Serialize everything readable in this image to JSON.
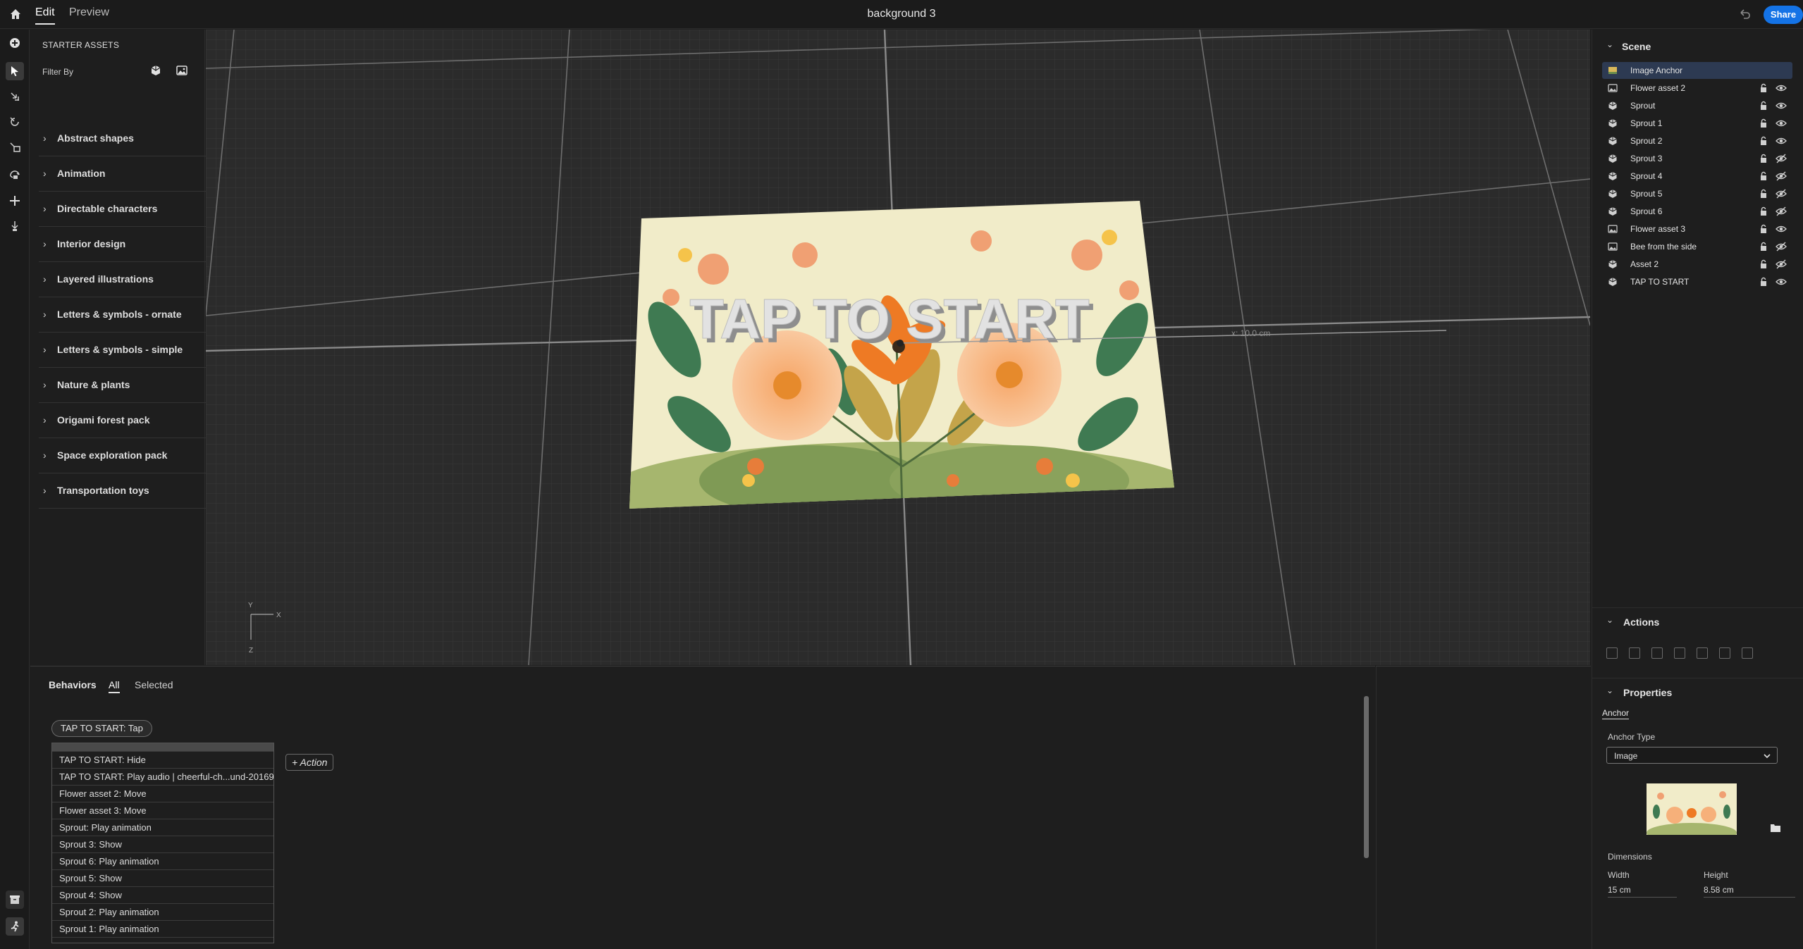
{
  "topbar": {
    "tabs": [
      "Edit",
      "Preview"
    ],
    "active_tab": "Edit",
    "document_title": "background 3",
    "share_label": "Share"
  },
  "tools": [
    "add-icon",
    "select-icon",
    "move-icon",
    "rotate-icon",
    "scale-icon",
    "orbit-camera-icon",
    "pan-camera-icon",
    "dolly-camera-icon"
  ],
  "assets": {
    "title": "STARTER ASSETS",
    "filter_label": "Filter By",
    "categories": [
      "Abstract shapes",
      "Animation",
      "Directable characters",
      "Interior design",
      "Layered illustrations",
      "Letters & symbols - ornate",
      "Letters & symbols - simple",
      "Nature & plants",
      "Origami forest pack",
      "Space exploration pack",
      "Transportation toys"
    ]
  },
  "viewport": {
    "scene_text": "TAP TO START",
    "measure_label": "x: 10.0 cm",
    "gizmo_x": "X",
    "gizmo_y": "Y",
    "gizmo_z": "Z"
  },
  "scene": {
    "title": "Scene",
    "layers": [
      {
        "name": "Image Anchor",
        "icon": "image-anchor-icon",
        "selected": true,
        "visible": true
      },
      {
        "name": "Flower asset 2",
        "icon": "image-icon",
        "visible": true
      },
      {
        "name": "Sprout",
        "icon": "model-icon",
        "visible": true
      },
      {
        "name": "Sprout 1",
        "icon": "model-icon",
        "visible": true
      },
      {
        "name": "Sprout 2",
        "icon": "model-icon",
        "visible": true
      },
      {
        "name": "Sprout 3",
        "icon": "model-icon",
        "visible": false
      },
      {
        "name": "Sprout 4",
        "icon": "model-icon",
        "visible": false
      },
      {
        "name": "Sprout 5",
        "icon": "model-icon",
        "visible": false
      },
      {
        "name": "Sprout 6",
        "icon": "model-icon",
        "visible": false
      },
      {
        "name": "Flower asset 3",
        "icon": "image-icon",
        "visible": true
      },
      {
        "name": "Bee from the side",
        "icon": "image-icon",
        "visible": false
      },
      {
        "name": "Asset 2",
        "icon": "model-icon",
        "visible": false
      },
      {
        "name": "TAP TO START",
        "icon": "model-icon",
        "visible": true
      }
    ]
  },
  "actions_panel": {
    "title": "Actions",
    "icons": [
      "delete-icon",
      "duplicate-icon",
      "group-icon",
      "download-icon",
      "fit-icon",
      "reset-icon",
      "replace-icon"
    ]
  },
  "properties": {
    "title": "Properties",
    "tab": "Anchor",
    "anchor_type_label": "Anchor Type",
    "anchor_type_value": "Image",
    "dimensions_label": "Dimensions",
    "width_label": "Width",
    "width_value": "15 cm",
    "height_label": "Height",
    "height_value": "8.58 cm"
  },
  "behaviors": {
    "title": "Behaviors",
    "tabs": [
      "All",
      "Selected"
    ],
    "active_tab": "All",
    "trigger": "TAP TO START:  Tap",
    "actions": [
      "TAP TO START:  Hide",
      "TAP TO START:  Play audio | cheerful-ch...und-201697",
      "Flower asset 2:  Move",
      "Flower asset 3:  Move",
      "Sprout:  Play animation",
      "Sprout 3:  Show",
      "Sprout 6:  Play animation",
      "Sprout 5:  Show",
      "Sprout 4:  Show",
      "Sprout 2:  Play animation",
      "Sprout 1:  Play animation"
    ],
    "add_action_label": "+ Action"
  },
  "colors": {
    "accent": "#1473e6",
    "background": "#1e1e1e",
    "viewport": "#2b2b2b",
    "selection": "#2d3a52",
    "artwork_bg": "#f1ecc9"
  }
}
